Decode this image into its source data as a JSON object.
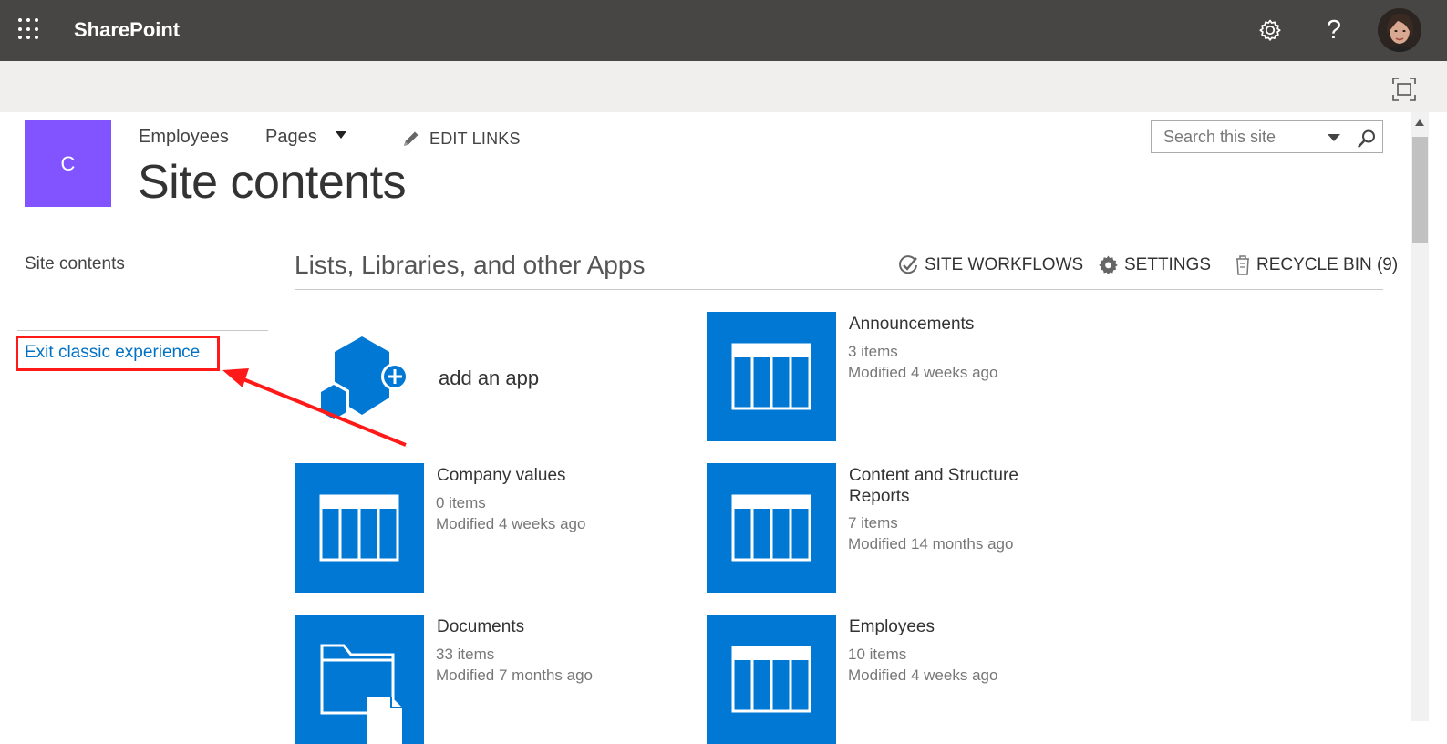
{
  "suite": {
    "brand": "SharePoint",
    "icons": {
      "waffle": "app-launcher-icon",
      "settings": "gear-icon",
      "help": "help-icon"
    },
    "help_symbol": "?"
  },
  "site": {
    "logo_letter": "C",
    "nav": {
      "employees": "Employees",
      "pages": "Pages",
      "edit_links": "EDIT LINKS"
    },
    "title": "Site contents",
    "search_placeholder": "Search this site"
  },
  "left_nav": {
    "site_contents": "Site contents",
    "exit_classic": "Exit classic experience"
  },
  "main": {
    "section_title": "Lists, Libraries, and other Apps",
    "commands": {
      "site_workflows": "SITE WORKFLOWS",
      "settings": "SETTINGS",
      "recycle_bin": "RECYCLE BIN (9)"
    },
    "add_app": "add an app",
    "apps": [
      {
        "title": "Announcements",
        "count": "3 items",
        "modified": "Modified 4 weeks ago",
        "icon": "list-icon"
      },
      {
        "title": "Company values",
        "count": "0 items",
        "modified": "Modified 4 weeks ago",
        "icon": "list-icon"
      },
      {
        "title": "Content and Structure Reports",
        "count": "7 items",
        "modified": "Modified 14 months ago",
        "icon": "list-icon"
      },
      {
        "title": "Documents",
        "count": "33 items",
        "modified": "Modified 7 months ago",
        "icon": "document-library-icon"
      },
      {
        "title": "Employees",
        "count": "10 items",
        "modified": "Modified 4 weeks ago",
        "icon": "list-icon"
      }
    ]
  },
  "colors": {
    "suite_bar": "#484644",
    "ribbon": "#f0efee",
    "site_logo": "#8154ff",
    "app_tile": "#0078d4",
    "link": "#0072c6",
    "annotation": "#ff1a1a"
  }
}
